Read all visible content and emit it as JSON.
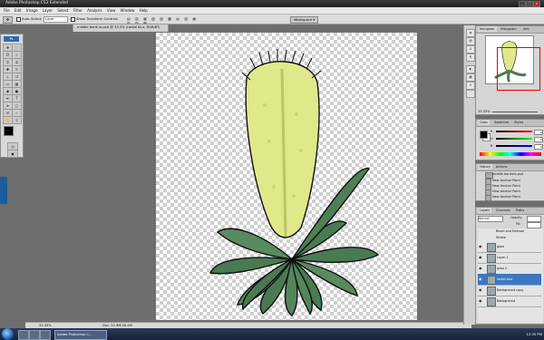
{
  "window": {
    "title": "Adobe Photoshop CS3 Extended"
  },
  "menu": [
    "File",
    "Edit",
    "Image",
    "Layer",
    "Select",
    "Filter",
    "Analysis",
    "View",
    "Window",
    "Help"
  ],
  "options": {
    "auto_select_label": "Auto-Select:",
    "auto_select_value": "Layer",
    "show_transform_label": "Show Transform Controls",
    "workspace_label": "Workspace ▾"
  },
  "document": {
    "tab_title": "middle bank ia.psd @ 33.3% (radial blur, RGB/8*)"
  },
  "toolbox": {
    "brand": "Ps"
  },
  "status": {
    "zoom": "33.33%",
    "doc": "Doc: 12.9M/26.4M"
  },
  "navigator": {
    "tabs": [
      "Navigator",
      "Histogram",
      "Info"
    ],
    "zoom": "33.33%"
  },
  "color": {
    "tabs": [
      "Color",
      "Swatches",
      "Styles"
    ],
    "channels": [
      "R",
      "G",
      "B"
    ],
    "values": [
      "0",
      "0",
      "0"
    ]
  },
  "history": {
    "tabs": [
      "History",
      "Actions"
    ],
    "snapshot": "middle banksia.psd",
    "items": [
      "New Anchor Point",
      "New Anchor Point",
      "New Anchor Point",
      "New Anchor Point"
    ]
  },
  "layers": {
    "tabs": [
      "Layers",
      "Channels",
      "Paths"
    ],
    "blend": "Normal",
    "opacity_label": "Opacity:",
    "fill_label": "Fill:",
    "effects": [
      "Bevel and Emboss",
      "Stroke"
    ],
    "items": [
      {
        "name": "glow",
        "selected": false
      },
      {
        "name": "Layer 1",
        "selected": false
      },
      {
        "name": "glow 2",
        "selected": false
      },
      {
        "name": "radial blur",
        "selected": true
      },
      {
        "name": "Background copy",
        "selected": false
      },
      {
        "name": "Background",
        "selected": false
      }
    ]
  },
  "taskbar": {
    "item": "Adobe Photoshop C...",
    "clock": "12:35 PM"
  },
  "colors": {
    "accent": "#3a78c2",
    "flower": "#dfe98a",
    "leaf": "#4a7a52"
  }
}
